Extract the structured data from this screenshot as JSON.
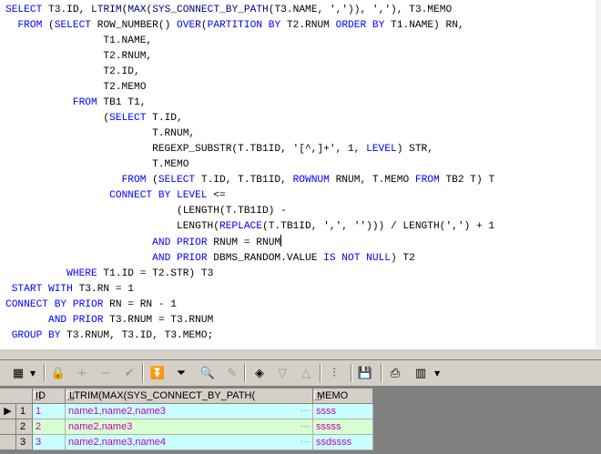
{
  "editor": {
    "lines": [
      [
        [
          "kw",
          "SELECT"
        ],
        [
          "t",
          " T3.ID, "
        ],
        [
          "fn",
          "LTRIM"
        ],
        [
          "t",
          "("
        ],
        [
          "fn",
          "MAX"
        ],
        [
          "t",
          "("
        ],
        [
          "fn",
          "SYS_CONNECT_BY_PATH"
        ],
        [
          "t",
          "(T3.NAME, ','"
        ],
        [
          "t",
          ")), ','), T3.MEMO"
        ]
      ],
      [
        [
          "t",
          "  "
        ],
        [
          "kw",
          "FROM"
        ],
        [
          "t",
          " ("
        ],
        [
          "kw",
          "SELECT"
        ],
        [
          "t",
          " ROW_NUMBER() "
        ],
        [
          "kw",
          "OVER"
        ],
        [
          "t",
          "("
        ],
        [
          "kw",
          "PARTITION BY"
        ],
        [
          "t",
          " T2.RNUM "
        ],
        [
          "kw",
          "ORDER BY"
        ],
        [
          "t",
          " T1.NAME) RN,"
        ]
      ],
      [
        [
          "t",
          "                T1.NAME,"
        ]
      ],
      [
        [
          "t",
          "                T2.RNUM,"
        ]
      ],
      [
        [
          "t",
          "                T2.ID,"
        ]
      ],
      [
        [
          "t",
          "                T2.MEMO"
        ]
      ],
      [
        [
          "t",
          "           "
        ],
        [
          "kw",
          "FROM"
        ],
        [
          "t",
          " TB1 T1,"
        ]
      ],
      [
        [
          "t",
          "                ("
        ],
        [
          "kw",
          "SELECT"
        ],
        [
          "t",
          " T.ID,"
        ]
      ],
      [
        [
          "t",
          "                        T.RNUM,"
        ]
      ],
      [
        [
          "t",
          "                        REGEXP_SUBSTR(T.TB1ID, '[^,]+', 1, "
        ],
        [
          "kw",
          "LEVEL"
        ],
        [
          "t",
          ") STR,"
        ]
      ],
      [
        [
          "t",
          "                        T.MEMO"
        ]
      ],
      [
        [
          "t",
          "                   "
        ],
        [
          "kw",
          "FROM"
        ],
        [
          "t",
          " ("
        ],
        [
          "kw",
          "SELECT"
        ],
        [
          "t",
          " T.ID, T.TB1ID, "
        ],
        [
          "kw",
          "ROWNUM"
        ],
        [
          "t",
          " RNUM, T.MEMO "
        ],
        [
          "kw",
          "FROM"
        ],
        [
          "t",
          " TB2 T) T"
        ]
      ],
      [
        [
          "t",
          "                 "
        ],
        [
          "kw",
          "CONNECT BY LEVEL"
        ],
        [
          "t",
          " <="
        ]
      ],
      [
        [
          "t",
          "                            (LENGTH(T.TB1ID) -"
        ]
      ],
      [
        [
          "t",
          "                            LENGTH("
        ],
        [
          "kw",
          "REPLACE"
        ],
        [
          "t",
          "(T.TB1ID, ',', ''))) / LENGTH(',') + 1"
        ]
      ],
      [
        [
          "t",
          "                        "
        ],
        [
          "kw",
          "AND PRIOR"
        ],
        [
          "t",
          " RNUM = RNUM"
        ],
        [
          "caret",
          ""
        ]
      ],
      [
        [
          "t",
          "                        "
        ],
        [
          "kw",
          "AND PRIOR"
        ],
        [
          "t",
          " DBMS_RANDOM.VALUE "
        ],
        [
          "kw",
          "IS NOT NULL"
        ],
        [
          "t",
          ") T2"
        ]
      ],
      [
        [
          "t",
          "          "
        ],
        [
          "kw",
          "WHERE"
        ],
        [
          "t",
          " T1.ID = T2.STR) T3"
        ]
      ],
      [
        [
          "t",
          " "
        ],
        [
          "kw",
          "START WITH"
        ],
        [
          "t",
          " T3.RN = 1"
        ]
      ],
      [
        [
          "kw",
          "CONNECT BY PRIOR"
        ],
        [
          "t",
          " RN = RN - 1"
        ]
      ],
      [
        [
          "t",
          "       "
        ],
        [
          "kw",
          "AND PRIOR"
        ],
        [
          "t",
          " T3.RNUM = T3.RNUM"
        ]
      ],
      [
        [
          "t",
          " "
        ],
        [
          "kw",
          "GROUP BY"
        ],
        [
          "t",
          " T3.RNUM, T3.ID, T3.MEMO;"
        ]
      ]
    ]
  },
  "toolbar": {
    "buttons": [
      {
        "name": "grid-options-icon",
        "glyph": "▦",
        "disabled": false
      },
      {
        "name": "lock-icon",
        "glyph": "🔒",
        "disabled": false
      },
      {
        "name": "add-record-icon",
        "glyph": "+",
        "disabled": true
      },
      {
        "name": "delete-record-icon",
        "glyph": "−",
        "disabled": true
      },
      {
        "name": "post-changes-icon",
        "glyph": "✔",
        "disabled": true
      },
      {
        "name": "query-all-records-icon",
        "glyph": "⏬",
        "disabled": false
      },
      {
        "name": "next-page-icon",
        "glyph": "⏷",
        "disabled": false
      },
      {
        "name": "find-binoculars-icon",
        "glyph": "🔍",
        "disabled": false
      },
      {
        "name": "clear-eraser-icon",
        "glyph": "✎",
        "disabled": true
      },
      {
        "name": "filter-records-icon",
        "glyph": "◈",
        "disabled": false
      },
      {
        "name": "previous-record-icon",
        "glyph": "▽",
        "disabled": true
      },
      {
        "name": "next-record-icon",
        "glyph": "△",
        "disabled": true
      },
      {
        "name": "explain-plan-icon",
        "glyph": "⫶",
        "disabled": false
      },
      {
        "name": "save-icon",
        "glyph": "💾",
        "disabled": false
      },
      {
        "name": "print-icon",
        "glyph": "⎙",
        "disabled": false
      },
      {
        "name": "chart-icon",
        "glyph": "▥",
        "disabled": false
      }
    ]
  },
  "grid": {
    "columns": [
      "ID",
      "LTRIM(MAX(SYS_CONNECT_BY_PATH(",
      "MEMO"
    ],
    "rows": [
      {
        "num": "1",
        "current": true,
        "cells": [
          "1",
          "name1,name2,name3",
          "ssss"
        ]
      },
      {
        "num": "2",
        "current": false,
        "cells": [
          "2",
          "name2,name3",
          "sssss"
        ]
      },
      {
        "num": "3",
        "current": false,
        "cells": [
          "3",
          "name2,name3,name4",
          "ssdssss"
        ]
      }
    ],
    "current_row_marker": "▶",
    "ellipsis": "···"
  }
}
